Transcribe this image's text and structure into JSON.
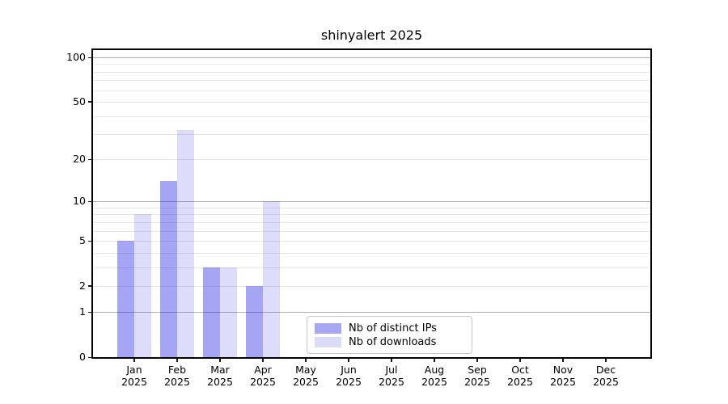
{
  "title": "shinyalert 2025",
  "chart_data": {
    "type": "bar",
    "title": "shinyalert 2025",
    "categories": [
      "Jan",
      "Feb",
      "Mar",
      "Apr",
      "May",
      "Jun",
      "Jul",
      "Aug",
      "Sep",
      "Oct",
      "Nov",
      "Dec"
    ],
    "x_tick_year": "2025",
    "series": [
      {
        "name": "Nb of distinct IPs",
        "values": [
          5,
          14,
          3,
          2,
          0,
          0,
          0,
          0,
          0,
          0,
          0,
          0
        ],
        "bar_color": "rgba(30,30,225,0.40)",
        "legend_color": "#a6a6f3"
      },
      {
        "name": "Nb of downloads",
        "values": [
          8,
          32,
          3,
          10,
          0,
          0,
          0,
          0,
          0,
          0,
          0,
          0
        ],
        "bar_color": "rgba(30,30,225,0.15)",
        "legend_color": "#dcdcf8"
      }
    ],
    "y_scale": "log1p",
    "y_max": 112,
    "y_ticks": [
      0,
      1,
      2,
      5,
      10,
      20,
      50,
      100
    ],
    "major_gridline_values": [
      1,
      10,
      100
    ],
    "minor_gridline_values": [
      2,
      3,
      4,
      5,
      6,
      7,
      8,
      9,
      20,
      30,
      40,
      50,
      60,
      70,
      80,
      90
    ],
    "colors": {
      "major_grid": "#b0b0b0",
      "minor_grid": "#e8e8e8",
      "spine": "#000000",
      "background": "#ffffff"
    },
    "legend_position": "bottom-center",
    "grid": "on"
  }
}
